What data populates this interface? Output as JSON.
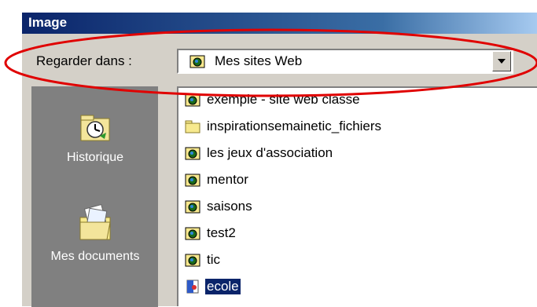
{
  "window": {
    "title": "Image"
  },
  "look_in": {
    "label": "Regarder dans :",
    "selected": "Mes sites Web",
    "icon": "globe-folder-icon"
  },
  "places": [
    {
      "label": "Historique",
      "icon": "history-icon"
    },
    {
      "label": "Mes documents",
      "icon": "my-documents-icon"
    }
  ],
  "files": [
    {
      "name": "exemple - site web classe",
      "icon": "globe-folder-icon",
      "selected": false
    },
    {
      "name": "inspirationsemainetic_fichiers",
      "icon": "folder-icon",
      "selected": false
    },
    {
      "name": "les jeux d'association",
      "icon": "globe-folder-icon",
      "selected": false
    },
    {
      "name": "mentor",
      "icon": "globe-folder-icon",
      "selected": false
    },
    {
      "name": "saisons",
      "icon": "globe-folder-icon",
      "selected": false
    },
    {
      "name": "test2",
      "icon": "globe-folder-icon",
      "selected": false
    },
    {
      "name": "tic",
      "icon": "globe-folder-icon",
      "selected": false
    },
    {
      "name": "ecole",
      "icon": "web-file-icon",
      "selected": true
    }
  ],
  "colors": {
    "titlebar": "#0a246a",
    "dialog_bg": "#d4d0c8",
    "selection": "#0a246a",
    "annotation": "#e00000"
  }
}
